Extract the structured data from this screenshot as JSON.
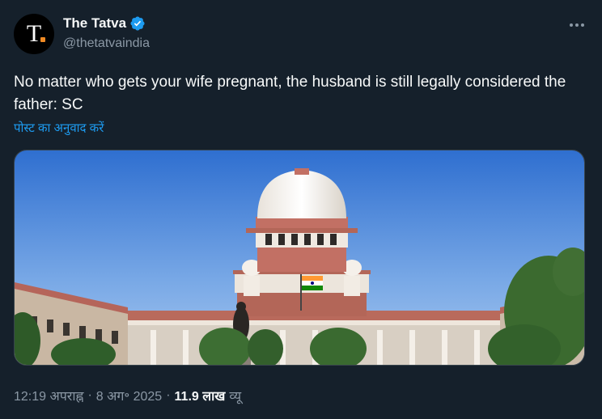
{
  "author": {
    "display_name": "The Tatva",
    "handle": "@thetatvaindia",
    "avatar_letter": "T.",
    "verified": true
  },
  "tweet": {
    "text": "No matter who gets your wife pregnant, the husband is still legally considered the father: SC",
    "translate_label": "पोस्ट का अनुवाद करें"
  },
  "media": {
    "description_icon": "photo-supreme-court"
  },
  "meta": {
    "time": "12:19 अपराह्न",
    "separator": "·",
    "date": "8 अग॰ 2025",
    "views_count": "11.9 लाख",
    "views_label": "व्यू"
  },
  "colors": {
    "background": "#15202b",
    "text": "#f7f9f9",
    "secondary": "#8b98a5",
    "link": "#1d9bf0",
    "verified": "#1d9bf0"
  },
  "icons": {
    "verified": "verified-badge-icon",
    "more": "more-options-icon"
  }
}
